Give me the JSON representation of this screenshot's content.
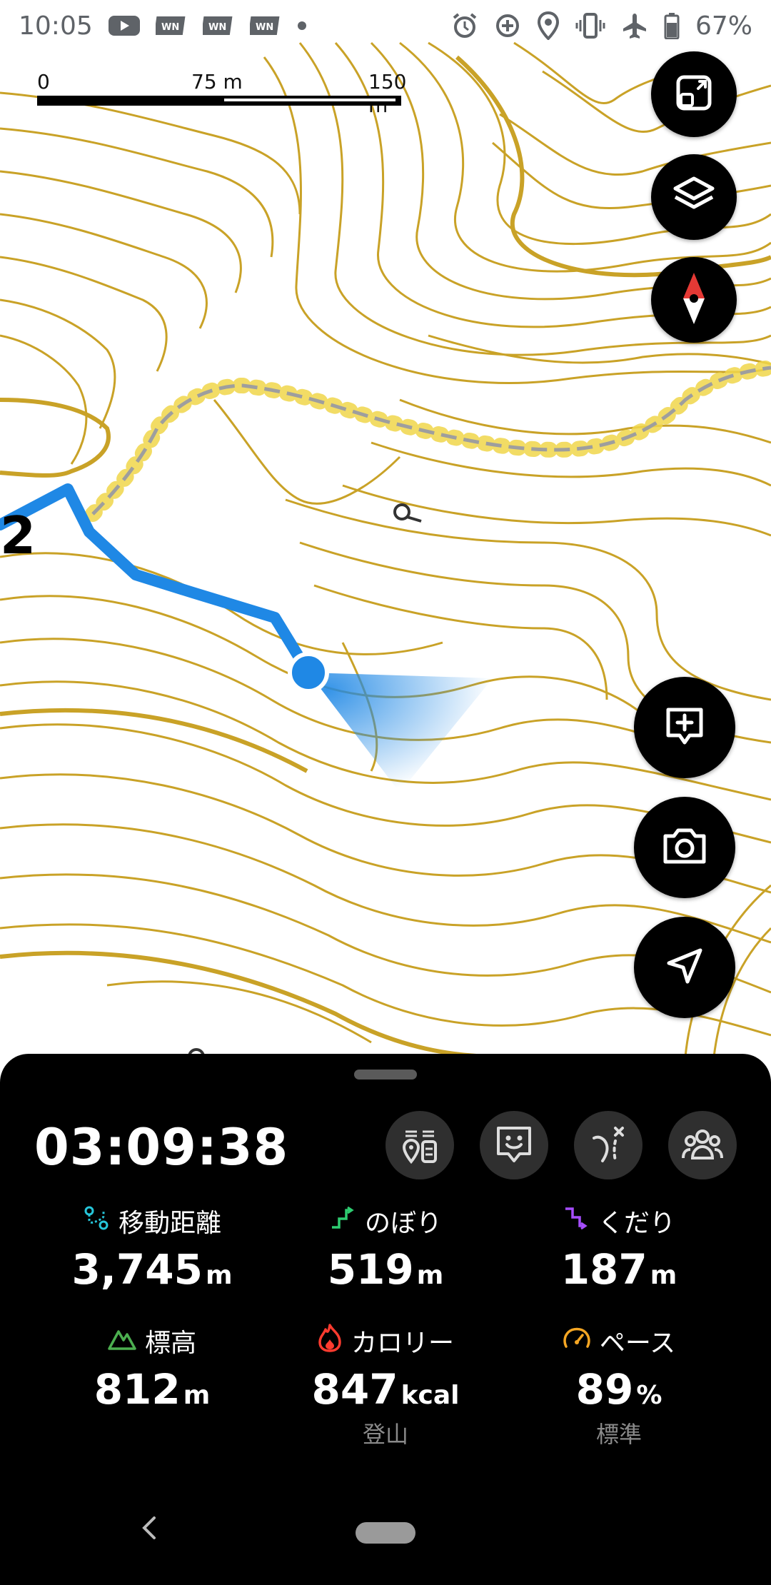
{
  "status_bar": {
    "time": "10:05",
    "left_icons": [
      "youtube-icon",
      "app-icon",
      "app-icon",
      "app-icon",
      "dot-icon"
    ],
    "right_icons": [
      "alarm-icon",
      "data-saver-icon",
      "location-icon",
      "vibrate-icon",
      "airplane-icon",
      "battery-icon"
    ],
    "battery": "67%"
  },
  "map": {
    "scale": {
      "zero": "0",
      "mid": "75 m",
      "max": "150 m"
    },
    "marker_label": "2",
    "colors": {
      "contour": "#c9a227",
      "track": "#1f88e5",
      "trail": "#9e9e9e"
    }
  },
  "map_buttons": {
    "fit": "fit-screen-icon",
    "layers": "layers-icon",
    "compass": "compass-icon",
    "memo": "add-memo-icon",
    "camera": "camera-icon",
    "navigate": "navigation-arrow-icon"
  },
  "activity": {
    "elapsed": "03:09:38",
    "actions": [
      "checkpoint-icon",
      "face-icon",
      "route-icon",
      "group-icon"
    ],
    "stats": {
      "distance": {
        "label": "移動距離",
        "value": "3,745",
        "unit": "m",
        "icon_color": "#26c6da"
      },
      "ascent": {
        "label": "のぼり",
        "value": "519",
        "unit": "m",
        "icon_color": "#2ecc71"
      },
      "descent": {
        "label": "くだり",
        "value": "187",
        "unit": "m",
        "icon_color": "#a64dff"
      },
      "altitude": {
        "label": "標高",
        "value": "812",
        "unit": "m",
        "icon_color": "#4caf50"
      },
      "calorie": {
        "label": "カロリー",
        "value": "847",
        "unit": "kcal",
        "sub": "登山",
        "icon_color": "#ff3b2f"
      },
      "pace": {
        "label": "ペース",
        "value": "89",
        "unit": "%",
        "sub": "標準",
        "icon_color": "#f5a623"
      }
    }
  }
}
